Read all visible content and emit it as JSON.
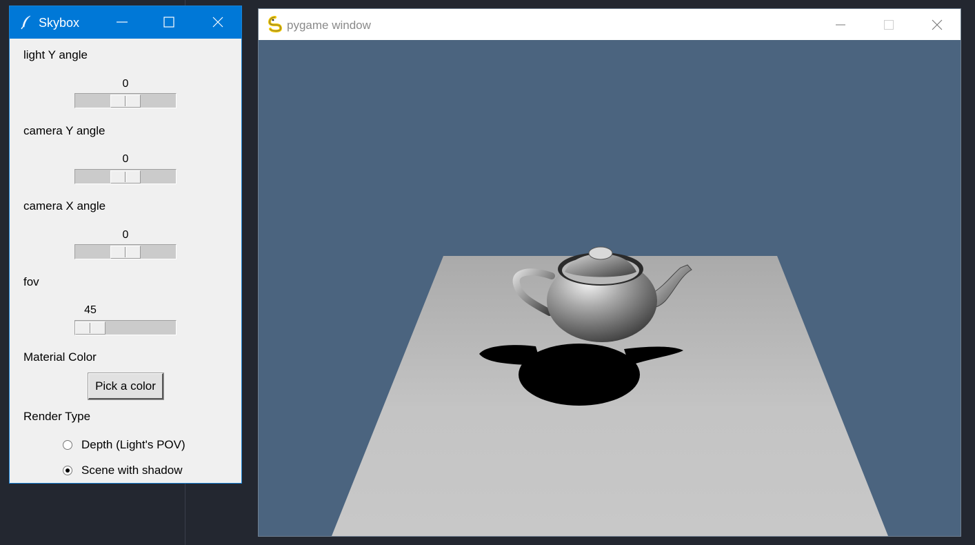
{
  "skybox_window": {
    "title": "Skybox",
    "controls": {
      "light_y": {
        "label": "light Y angle",
        "value": "0"
      },
      "camera_y": {
        "label": "camera Y angle",
        "value": "0"
      },
      "camera_x": {
        "label": "camera X angle",
        "value": "0"
      },
      "fov": {
        "label": "fov",
        "value": "45"
      }
    },
    "material_color": {
      "label": "Material Color",
      "button": "Pick a color"
    },
    "render_type": {
      "label": "Render Type",
      "options": [
        {
          "label": "Depth (Light's POV)",
          "checked": false
        },
        {
          "label": "Scene with shadow",
          "checked": true
        }
      ]
    }
  },
  "pygame_window": {
    "title": "pygame window",
    "background_color": "#4b647f"
  },
  "accent_color": "#0078d7"
}
